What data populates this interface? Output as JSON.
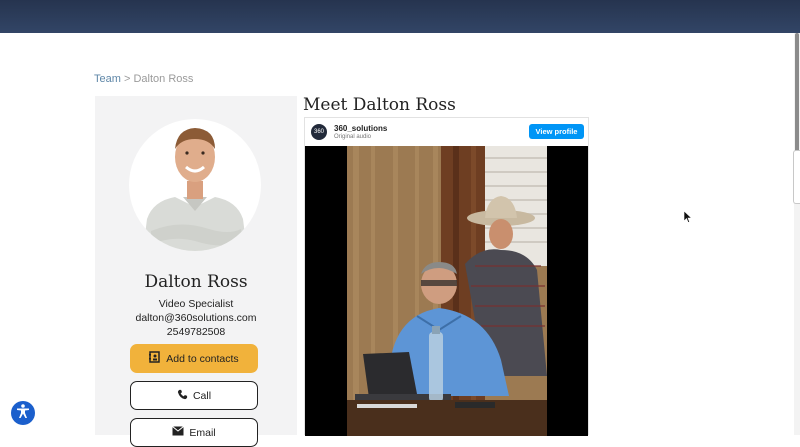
{
  "breadcrumb": {
    "team": "Team",
    "separator": ">",
    "current": "Dalton Ross"
  },
  "profile": {
    "name": "Dalton Ross",
    "role": "Video Specialist",
    "email": "dalton@360solutions.com",
    "phone": "2549782508",
    "add_contacts_label": "Add to contacts",
    "call_label": "Call",
    "email_label": "Email"
  },
  "main": {
    "heading": "Meet Dalton Ross"
  },
  "embed": {
    "account": "360_solutions",
    "audio": "Original audio",
    "view_profile": "View profile",
    "logo_text": "360"
  },
  "colors": {
    "header": "#2b3a56",
    "accent_button": "#f1b23b",
    "instagram_blue": "#0095f6",
    "accessibility_blue": "#1b5fcc"
  }
}
